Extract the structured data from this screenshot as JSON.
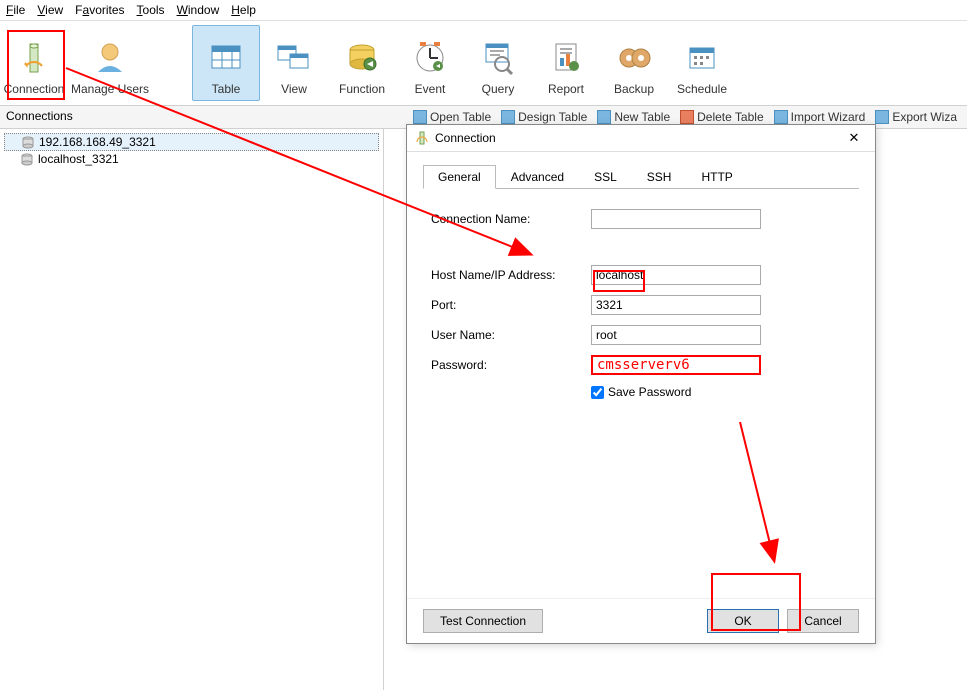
{
  "menubar": {
    "file": "File",
    "view": "View",
    "favorites": "Favorites",
    "tools": "Tools",
    "window": "Window",
    "help": "Help"
  },
  "toolbar": {
    "connection": "Connection",
    "manage_users": "Manage Users",
    "table": "Table",
    "view": "View",
    "function": "Function",
    "event": "Event",
    "query": "Query",
    "report": "Report",
    "backup": "Backup",
    "schedule": "Schedule"
  },
  "connections_panel": {
    "title": "Connections",
    "items": [
      "192.168.168.49_3321",
      "localhost_3321"
    ]
  },
  "subtoolbar": {
    "open_table": "Open Table",
    "design_table": "Design Table",
    "new_table": "New Table",
    "delete_table": "Delete Table",
    "import_wizard": "Import Wizard",
    "export_wizard": "Export Wiza"
  },
  "dialog": {
    "title": "Connection",
    "tabs": {
      "general": "General",
      "advanced": "Advanced",
      "ssl": "SSL",
      "ssh": "SSH",
      "http": "HTTP"
    },
    "labels": {
      "conn_name": "Connection Name:",
      "host": "Host Name/IP Address:",
      "port": "Port:",
      "user": "User Name:",
      "password": "Password:",
      "save_password": "Save Password"
    },
    "values": {
      "conn_name": "",
      "host": "localhost",
      "port": "3321",
      "user": "root",
      "password_display": "cmsserverv6"
    },
    "buttons": {
      "test": "Test Connection",
      "ok": "OK",
      "cancel": "Cancel"
    }
  }
}
